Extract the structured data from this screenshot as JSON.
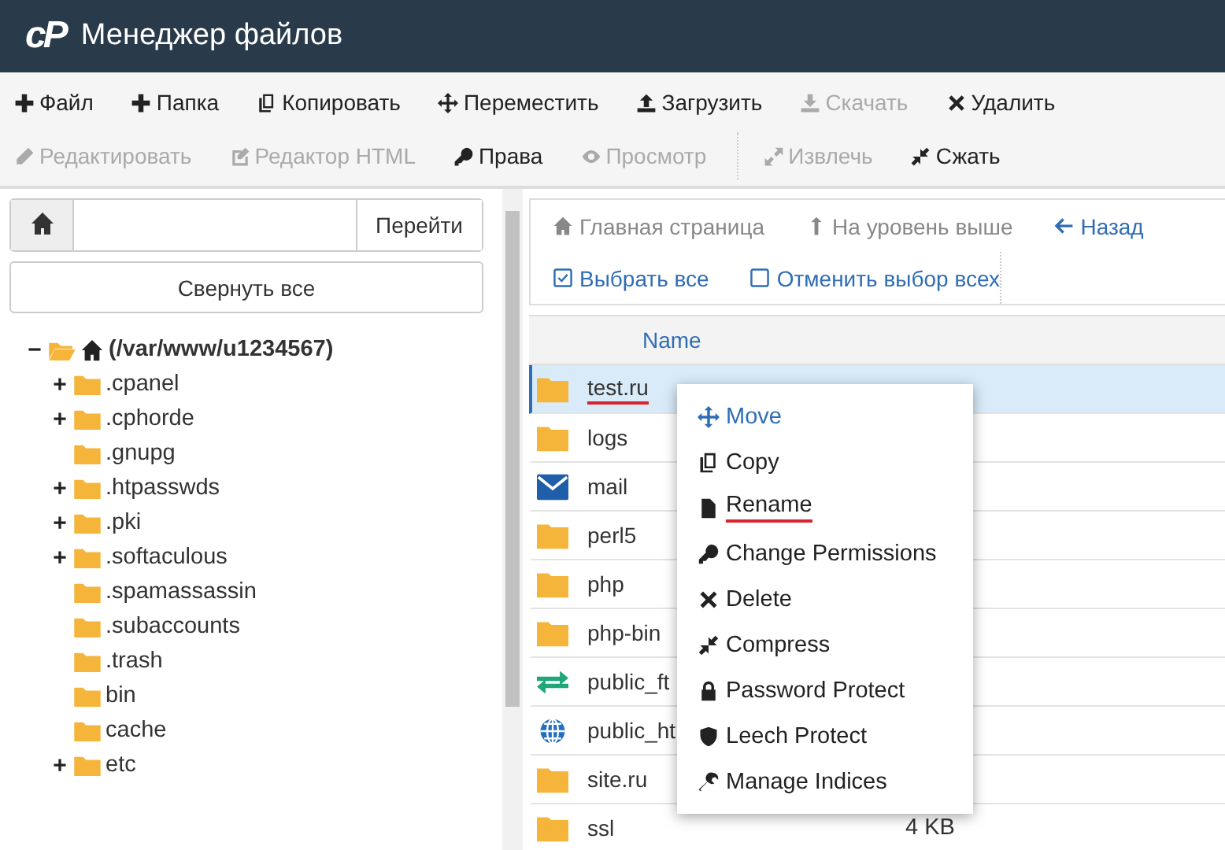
{
  "header": {
    "logo": "cP",
    "title": "Менеджер файлов"
  },
  "toolbar": [
    [
      {
        "label": "Файл",
        "disabled": false
      },
      {
        "label": "Папка",
        "disabled": false
      },
      {
        "label": "Копировать",
        "disabled": false
      },
      {
        "label": "Переместить",
        "disabled": false
      },
      {
        "label": "Загрузить",
        "disabled": false
      },
      {
        "label": "Скачать",
        "disabled": true
      },
      {
        "label": "Удалить",
        "disabled": false
      }
    ],
    [
      {
        "label": "Редактировать",
        "disabled": true
      },
      {
        "label": "Редактор HTML",
        "disabled": true
      },
      {
        "label": "Права",
        "disabled": false
      },
      {
        "label": "Просмотр",
        "disabled": true
      },
      {
        "label": "Извлечь",
        "disabled": true
      },
      {
        "label": "Сжать",
        "disabled": false
      }
    ]
  ],
  "path_bar": {
    "go_button": "Перейти"
  },
  "collapse_button": "Свернуть все",
  "tree": {
    "label": "(/var/www/u1234567)",
    "toggle": "−",
    "children": [
      {
        "label": ".cpanel",
        "toggle": "+"
      },
      {
        "label": ".cphorde",
        "toggle": "+"
      },
      {
        "label": ".gnupg"
      },
      {
        "label": ".htpasswds",
        "toggle": "+"
      },
      {
        "label": ".pki",
        "toggle": "+"
      },
      {
        "label": ".softaculous",
        "toggle": "+"
      },
      {
        "label": ".spamassassin"
      },
      {
        "label": ".subaccounts"
      },
      {
        "label": ".trash"
      },
      {
        "label": "bin"
      },
      {
        "label": "cache"
      },
      {
        "label": "etc",
        "toggle": "+"
      }
    ]
  },
  "nav": [
    {
      "label": "Главная страница",
      "disabled": true
    },
    {
      "label": "На уровень выше",
      "disabled": true
    },
    {
      "label": "Назад",
      "disabled": false
    }
  ],
  "selection": [
    {
      "label": "Выбрать все"
    },
    {
      "label": "Отменить выбор всех"
    }
  ],
  "table": {
    "columns": [
      "Name"
    ],
    "rows": [
      {
        "kind": "folder",
        "name": "test.ru",
        "selected": true,
        "underlined": true
      },
      {
        "kind": "folder",
        "name": "logs",
        "selected": false,
        "underlined": false
      },
      {
        "kind": "mail",
        "name": "mail",
        "selected": false,
        "underlined": false
      },
      {
        "kind": "folder",
        "name": "perl5",
        "selected": false,
        "underlined": false
      },
      {
        "kind": "folder",
        "name": "php",
        "selected": false,
        "underlined": false
      },
      {
        "kind": "folder",
        "name": "php-bin",
        "selected": false,
        "underlined": false
      },
      {
        "kind": "transfer",
        "name": "public_ft",
        "selected": false,
        "underlined": false
      },
      {
        "kind": "globe",
        "name": "public_ht",
        "selected": false,
        "underlined": false
      },
      {
        "kind": "folder",
        "name": "site.ru",
        "selected": false,
        "underlined": false
      },
      {
        "kind": "folder",
        "name": "ssl",
        "size": "4 KB",
        "selected": false,
        "underlined": false
      }
    ]
  },
  "context_menu": [
    {
      "label": "Move",
      "highlighted": true,
      "underlined": false
    },
    {
      "label": "Copy",
      "highlighted": false,
      "underlined": false
    },
    {
      "label": "Rename",
      "highlighted": false,
      "underlined": true
    },
    {
      "label": "Change Permissions",
      "highlighted": false,
      "underlined": false
    },
    {
      "label": "Delete",
      "highlighted": false,
      "underlined": false
    },
    {
      "label": "Compress",
      "highlighted": false,
      "underlined": false
    },
    {
      "label": "Password Protect",
      "highlighted": false,
      "underlined": false
    },
    {
      "label": "Leech Protect",
      "highlighted": false,
      "underlined": false
    },
    {
      "label": "Manage Indices",
      "highlighted": false,
      "underlined": false
    }
  ]
}
